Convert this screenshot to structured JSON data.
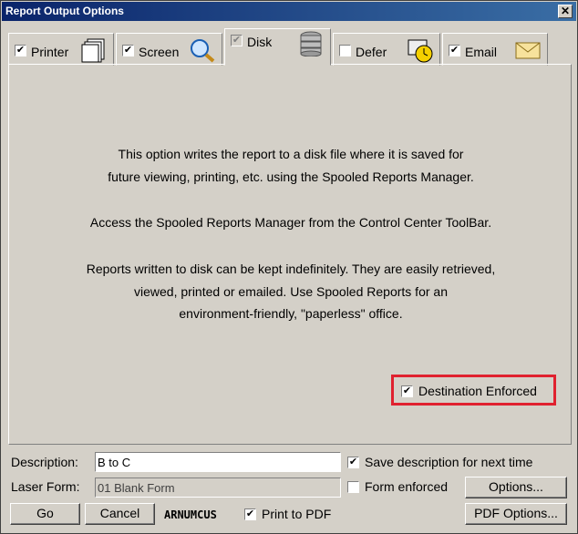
{
  "window": {
    "title": "Report Output Options",
    "close_glyph": "✕"
  },
  "tabs": [
    {
      "label": "Printer",
      "checked": true,
      "icon": "printer-icon"
    },
    {
      "label": "Screen",
      "checked": true,
      "icon": "magnifier-icon"
    },
    {
      "label": "Disk",
      "checked": true,
      "icon": "disk-stack-icon"
    },
    {
      "label": "Defer",
      "checked": false,
      "icon": "clock-icon"
    },
    {
      "label": "Email",
      "checked": true,
      "icon": "envelope-icon"
    }
  ],
  "info": {
    "line1": "This option writes the report to a disk file where it is saved for",
    "line2": "future viewing, printing, etc. using the Spooled Reports Manager.",
    "line3": "Access the Spooled Reports Manager from the Control Center ToolBar.",
    "line4": "Reports written to disk can be kept indefinitely.  They are easily retrieved,",
    "line5": "viewed, printed or emailed.  Use Spooled Reports for an",
    "line6": "environment-friendly, \"paperless\" office."
  },
  "destination_enforced": {
    "label": "Destination Enforced",
    "checked": true
  },
  "description": {
    "label": "Description:",
    "value": "B to C"
  },
  "save_description": {
    "label": "Save description for next time",
    "checked": true
  },
  "laser_form": {
    "label": "Laser Form:",
    "value": "01 Blank Form"
  },
  "form_enforced": {
    "label": "Form enforced",
    "checked": false
  },
  "buttons": {
    "options": "Options...",
    "go": "Go",
    "cancel": "Cancel",
    "pdf_options": "PDF Options..."
  },
  "report_code": "ARNUMCUS",
  "print_to_pdf": {
    "label": "Print to PDF",
    "checked": true
  },
  "check_glyph": "✔",
  "colors": {
    "highlight_border": "#e0212f",
    "title_start": "#0a246a",
    "title_end": "#3a6ea5"
  }
}
